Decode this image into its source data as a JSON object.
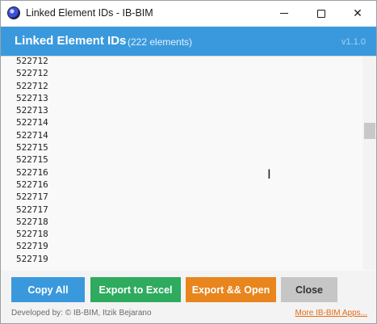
{
  "window": {
    "title": "Linked Element IDs - IB-BIM"
  },
  "header": {
    "title": "Linked Element IDs",
    "count": "(222 elements)",
    "version": "v1.1.0"
  },
  "list": {
    "items": [
      "522712",
      "522712",
      "522712",
      "522713",
      "522713",
      "522714",
      "522714",
      "522715",
      "522715",
      "522716",
      "522716",
      "522717",
      "522717",
      "522718",
      "522718",
      "522719",
      "522719"
    ]
  },
  "buttons": {
    "copy_all": "Copy All",
    "export_excel": "Export to Excel",
    "export_open": "Export && Open",
    "close": "Close"
  },
  "footer": {
    "developer": "Developed by: © IB-BIM, Itzik Bejarano",
    "more_apps": "More IB-BIM Apps..."
  },
  "colors": {
    "accent": "#3a99dc",
    "excel": "#2eab5e",
    "export_open": "#e8851c",
    "close": "#c6c6c6",
    "link": "#e46c14"
  },
  "icons": {
    "app": "app-logo-icon",
    "minimize": "minimize-icon",
    "maximize": "maximize-icon",
    "close": "close-icon",
    "cursor": "text-cursor-icon"
  }
}
